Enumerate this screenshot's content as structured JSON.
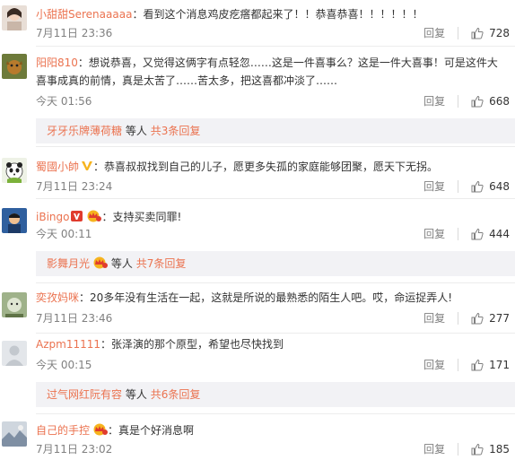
{
  "comments": [
    {
      "username": "小甜甜Serenaaaaa",
      "text": "看到这个消息鸡皮疙瘩都起来了！！恭喜恭喜！！！！！！",
      "time": "7月11日 23:36",
      "reply_label": "回复",
      "likes": "728"
    },
    {
      "username": "阳阳810",
      "text": "想说恭喜，又觉得这俩字有点轻忽……这是一件喜事么？这是一件大喜事！可是这件大喜事成真的前情，真是太苦了……苦太多，把这喜都冲淡了……",
      "time": "今天 01:56",
      "reply_label": "回复",
      "likes": "668",
      "sub_replies": {
        "who": "牙牙乐牌薄荷糖",
        "middle": "等人",
        "more": "共3条回复"
      }
    },
    {
      "username": "蜀國小帥",
      "text": "恭喜叔叔找到自己的儿子，愿更多失孤的家庭能够团聚，愿天下无拐。",
      "time": "7月11日 23:24",
      "reply_label": "回复",
      "likes": "648"
    },
    {
      "username": "iBingo",
      "text": "支持买卖同罪!",
      "time": "今天 00:11",
      "reply_label": "回复",
      "likes": "444",
      "sub_replies": {
        "who": "影舞月光",
        "middle": "等人",
        "more": "共7条回复"
      }
    },
    {
      "username": "奕孜妈咪",
      "text": "20多年没有生活在一起，这就是所说的最熟悉的陌生人吧。哎，命运捉弄人!",
      "time": "7月11日 23:46",
      "reply_label": "回复",
      "likes": "277"
    },
    {
      "username": "Azpm11111",
      "text": "张泽演的那个原型，希望也尽快找到",
      "time": "今天 00:15",
      "reply_label": "回复",
      "likes": "171",
      "sub_replies": {
        "who": "过气网红阮有容",
        "middle": "等人",
        "more": "共6条回复"
      }
    },
    {
      "username": "自己的手控",
      "text": "真是个好消息啊",
      "time": "7月11日 23:02",
      "reply_label": "回复",
      "likes": "185"
    }
  ],
  "colors": {
    "username": "#eb7350",
    "meta": "#808080",
    "reply_bg": "#f2f2f5"
  },
  "icons": {
    "like": "thumbs-up-icon",
    "verified": "yellow-v-icon",
    "vip": "vip-crown-icon"
  }
}
